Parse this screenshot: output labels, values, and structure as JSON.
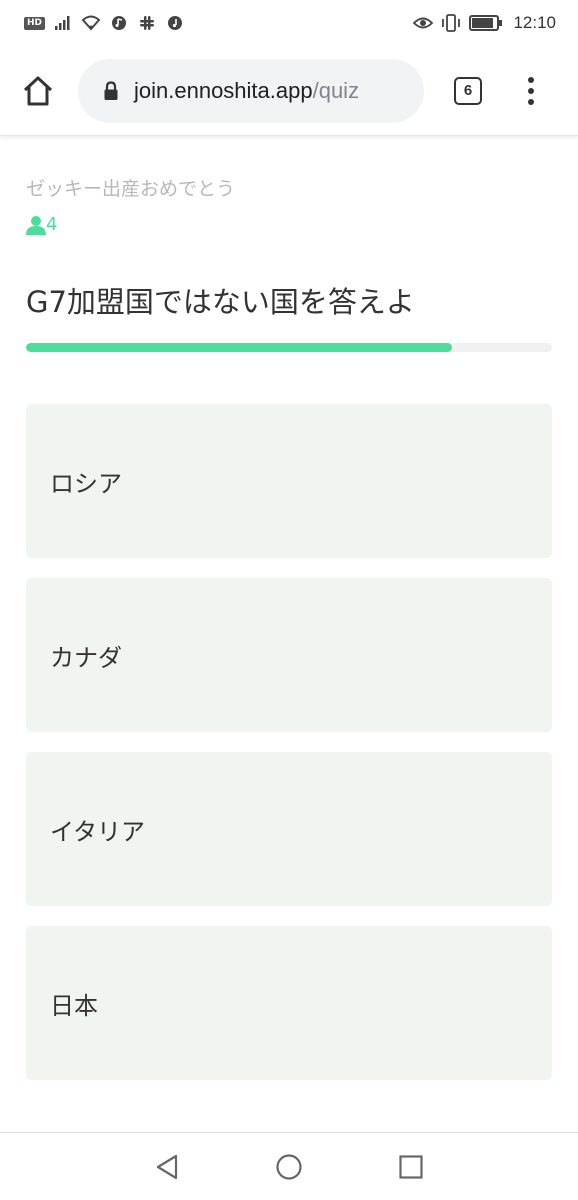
{
  "status_bar": {
    "time": "12:10",
    "badge": "HD",
    "icons": [
      "signal-icon",
      "wifi-icon",
      "music-app-icon",
      "slack-icon",
      "music-note-icon",
      "eye-comfort-icon",
      "vibrate-icon",
      "battery-icon"
    ]
  },
  "browser": {
    "url_domain": "join.ennoshita.app",
    "url_path": "/quiz",
    "tab_count": "6"
  },
  "quiz": {
    "room_title": "ゼッキー出産おめでとう",
    "participants": "4",
    "question": "G7加盟国ではない国を答えよ",
    "progress": 0.81,
    "answers": [
      {
        "label": "ロシア"
      },
      {
        "label": "カナダ"
      },
      {
        "label": "イタリア"
      },
      {
        "label": "日本"
      }
    ]
  },
  "colors": {
    "accent": "#4ddc9a",
    "answer_bg": "#f0f5f2",
    "muted_text": "#b8b8b8"
  }
}
